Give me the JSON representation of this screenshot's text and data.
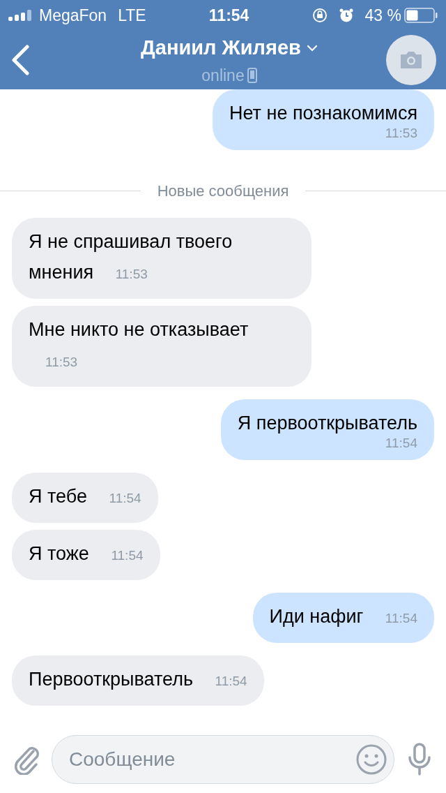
{
  "status_bar": {
    "carrier": "MegaFon",
    "network": "LTE",
    "time": "11:54",
    "battery": "43 %"
  },
  "header": {
    "name": "Даниил Жиляев",
    "status": "online"
  },
  "items": [
    {
      "kind": "sent",
      "text": "Нет не познакомимся",
      "time": "11:53"
    },
    {
      "kind": "divider",
      "text": "Новые сообщения"
    },
    {
      "kind": "received",
      "text": "Я не спрашивал твоего мнения",
      "time": "11:53"
    },
    {
      "kind": "received",
      "text": "Мне никто не отказывает",
      "time": "11:53"
    },
    {
      "kind": "sent",
      "text": "Я первооткрыватель",
      "time": "11:54"
    },
    {
      "kind": "received",
      "text": "Я тебе",
      "time": "11:54"
    },
    {
      "kind": "received",
      "text": "Я тоже",
      "time": "11:54"
    },
    {
      "kind": "sent",
      "text": "Иди нафиг",
      "time": "11:54"
    },
    {
      "kind": "received",
      "text": "Первооткрыватель",
      "time": "11:54"
    }
  ],
  "composer": {
    "placeholder": "Сообщение"
  }
}
